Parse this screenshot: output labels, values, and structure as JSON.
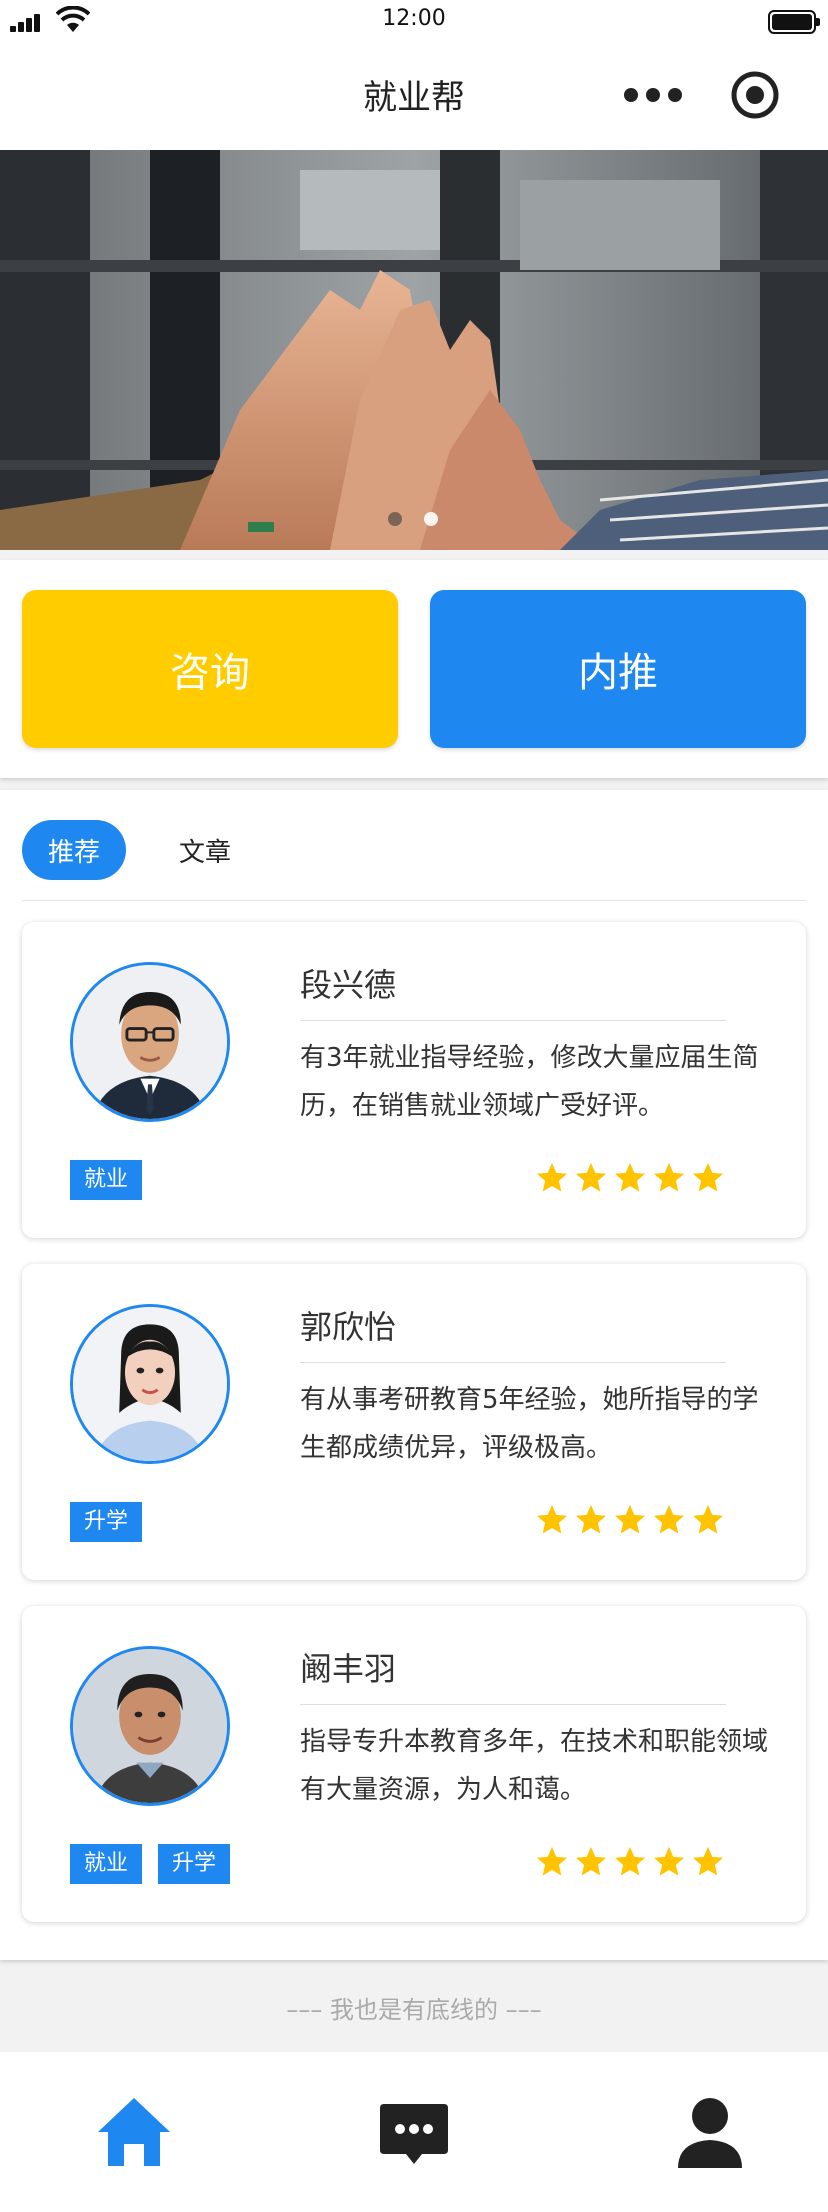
{
  "status_bar": {
    "time": "12:00"
  },
  "navbar": {
    "title": "就业帮",
    "more_icon": "more-dots-icon",
    "target_icon": "target-icon"
  },
  "banner": {
    "image": "high-five-hands-photo",
    "slides": 2,
    "active_slide": 2
  },
  "actions": {
    "consult_label": "咨询",
    "referral_label": "内推"
  },
  "colors": {
    "accent": "#1e87f0",
    "yellow": "#ffcc00",
    "star": "#ffc300"
  },
  "tabs": [
    {
      "label": "推荐",
      "active": true
    },
    {
      "label": "文章",
      "active": false
    }
  ],
  "mentors": [
    {
      "name": "段兴德",
      "description": "有3年就业指导经验，修改大量应届生简历，在销售就业领域广受好评。",
      "tags": [
        "就业"
      ],
      "rating": 5
    },
    {
      "name": "郭欣怡",
      "description": "有从事考研教育5年经验，她所指导的学生都成绩优异，评级极高。",
      "tags": [
        "升学"
      ],
      "rating": 5
    },
    {
      "name": "阚丰羽",
      "description": "指导专升本教育多年，在技术和职能领域有大量资源，为人和蔼。",
      "tags": [
        "就业",
        "升学"
      ],
      "rating": 5
    }
  ],
  "footer_note": "––– 我也是有底线的 –––",
  "tabbar": [
    {
      "icon": "home-icon",
      "active": true
    },
    {
      "icon": "chat-icon",
      "active": false
    },
    {
      "icon": "user-icon",
      "active": false
    }
  ]
}
